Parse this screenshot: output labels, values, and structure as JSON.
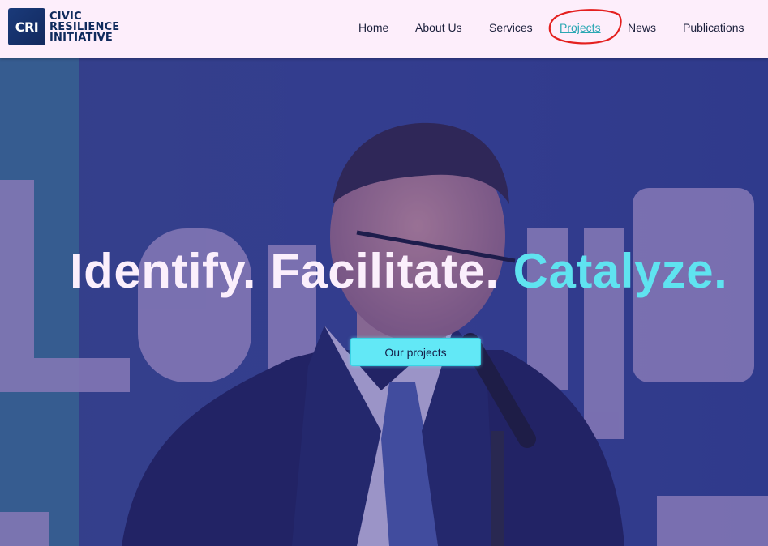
{
  "brand": {
    "logo_abbr": "CRI",
    "logo_lines": [
      "CIVIC",
      "RESILIENCE",
      "INITIATIVE"
    ]
  },
  "nav": {
    "items": [
      {
        "label": "Home"
      },
      {
        "label": "About Us"
      },
      {
        "label": "Services"
      },
      {
        "label": "Projects",
        "active": true
      },
      {
        "label": "News"
      },
      {
        "label": "Publications"
      }
    ]
  },
  "hero": {
    "headline_part1": "Identify. Facilitate.",
    "headline_accent": "Catalyze.",
    "cta_label": "Our projects"
  },
  "colors": {
    "header_bg": "#fdeefb",
    "nav_active": "#2aa7b3",
    "accent": "#5fe3f0",
    "cta_bg": "#62e8f6",
    "annotation": "#e4201f"
  }
}
